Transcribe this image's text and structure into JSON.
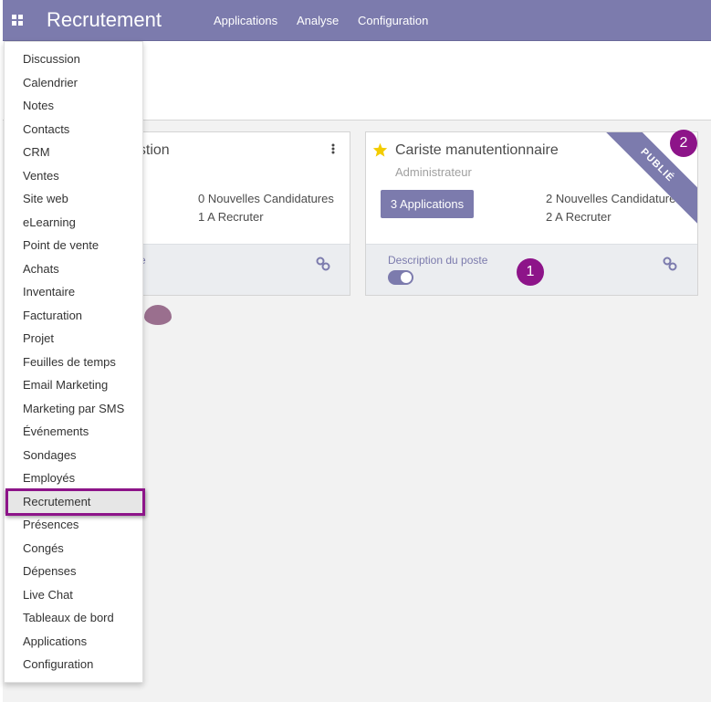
{
  "navbar": {
    "app_title": "Recrutement",
    "menu": [
      "Applications",
      "Analyse",
      "Configuration"
    ]
  },
  "cards": [
    {
      "title_fragment": "estion",
      "new_applications": "0 Nouvelles Candidatures",
      "to_recruit": "1 A Recruter",
      "footer_fragment": "e"
    },
    {
      "title": "Cariste manutentionnaire",
      "subtitle": "Administrateur",
      "applications_button": "3 Applications",
      "new_applications": "2 Nouvelles Candidatures",
      "to_recruit": "2 A Recruter",
      "ribbon": "PUBLIÉ",
      "footer_label": "Description du poste",
      "published": true
    }
  ],
  "badges": [
    "1",
    "2"
  ],
  "dropdown": {
    "items": [
      "Discussion",
      "Calendrier",
      "Notes",
      "Contacts",
      "CRM",
      "Ventes",
      "Site web",
      "eLearning",
      "Point de vente",
      "Achats",
      "Inventaire",
      "Facturation",
      "Projet",
      "Feuilles de temps",
      "Email Marketing",
      "Marketing par SMS",
      "Événements",
      "Sondages",
      "Employés",
      "Recrutement",
      "Présences",
      "Congés",
      "Dépenses",
      "Live Chat",
      "Tableaux de bord",
      "Applications",
      "Configuration"
    ],
    "active_item": "Recrutement"
  },
  "colors": {
    "brand": "#7c7bad",
    "annotation": "#8d1489",
    "star": "#f3cc00",
    "link_icon": "#7c7bad"
  }
}
